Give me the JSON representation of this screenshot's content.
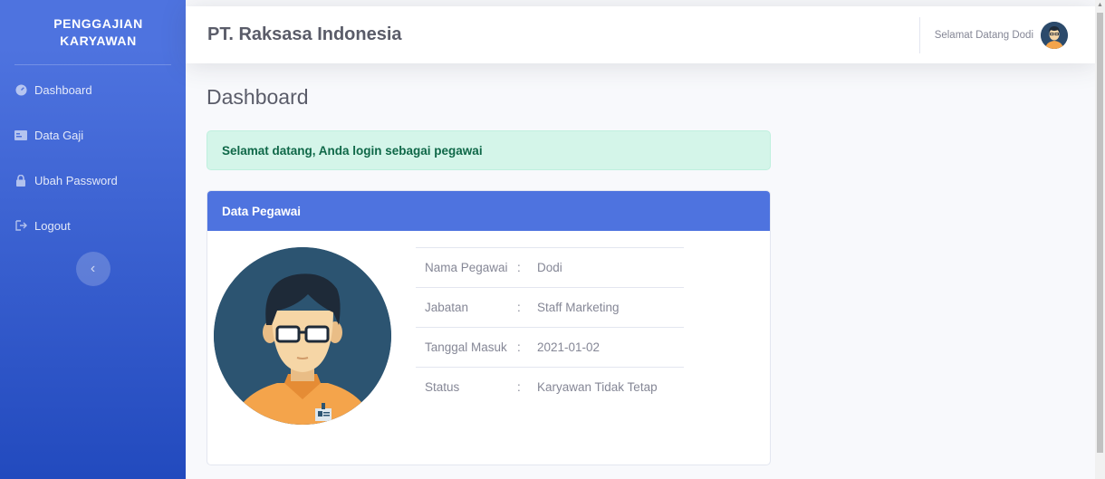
{
  "sidebar": {
    "brand": "PENGGAJIAN KARYAWAN",
    "items": [
      {
        "label": "Dashboard",
        "icon": "tachometer-icon"
      },
      {
        "label": "Data Gaji",
        "icon": "money-icon"
      },
      {
        "label": "Ubah Password",
        "icon": "lock-icon"
      },
      {
        "label": "Logout",
        "icon": "sign-out-icon"
      }
    ],
    "toggle_glyph": "‹"
  },
  "topbar": {
    "company": "PT. Raksasa Indonesia",
    "welcome": "Selamat Datang Dodi"
  },
  "main": {
    "page_title": "Dashboard",
    "alert": "Selamat datang, Anda login sebagai pegawai",
    "card_title": "Data Pegawai",
    "rows": [
      {
        "label": "Nama Pegawai",
        "sep": ":",
        "value": "Dodi"
      },
      {
        "label": "Jabatan",
        "sep": ":",
        "value": "Staff Marketing"
      },
      {
        "label": "Tanggal Masuk",
        "sep": ":",
        "value": "2021-01-02"
      },
      {
        "label": "Status",
        "sep": ":",
        "value": "Karyawan Tidak Tetap"
      }
    ]
  },
  "colors": {
    "primary": "#4e73df",
    "sidebar_dark": "#224abe",
    "success_bg": "#d4f5e9",
    "success_text": "#0f6848"
  }
}
